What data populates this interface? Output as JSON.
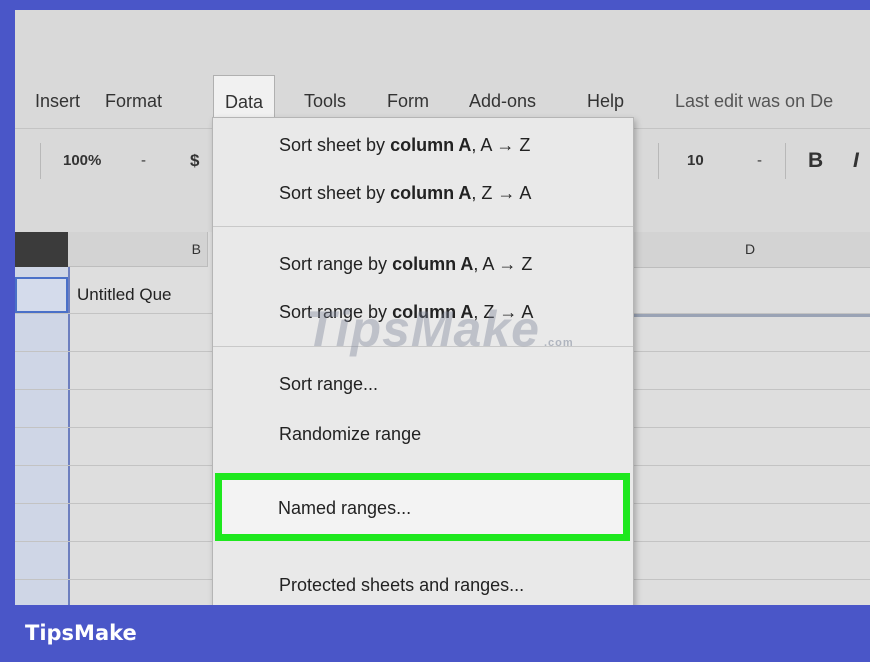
{
  "menubar": {
    "items": [
      "Insert",
      "Format",
      "Data",
      "Tools",
      "Form",
      "Add-ons",
      "Help"
    ],
    "last_edit": "Last edit was on De"
  },
  "toolbar": {
    "zoom": "100%",
    "zoom_caret": "-",
    "currency": "$",
    "font_size": "10",
    "font_size_caret": "-",
    "bold": "B",
    "italic": "I"
  },
  "grid": {
    "col_b": "B",
    "col_d": "D",
    "cell_b1": "Untitled Que"
  },
  "data_menu": {
    "sort_sheet_az": {
      "pre": "Sort sheet by ",
      "bold": "column A",
      "post": ", A → Z"
    },
    "sort_sheet_za": {
      "pre": "Sort sheet by ",
      "bold": "column A",
      "post": ", Z → A"
    },
    "sort_range_az": {
      "pre": "Sort range by ",
      "bold": "column A",
      "post": ", A → Z"
    },
    "sort_range_za": {
      "pre": "Sort range by ",
      "bold": "column A",
      "post": ", Z → A"
    },
    "sort_range": "Sort range...",
    "randomize_range": "Randomize range",
    "named_ranges": "Named ranges...",
    "protected": "Protected sheets and ranges..."
  },
  "watermark": {
    "text": "TipsMake",
    "suffix": ".com"
  },
  "branding": {
    "name": "TipsMake"
  },
  "colors": {
    "highlight": "#1ee81e",
    "frame": "#4a56c8"
  }
}
